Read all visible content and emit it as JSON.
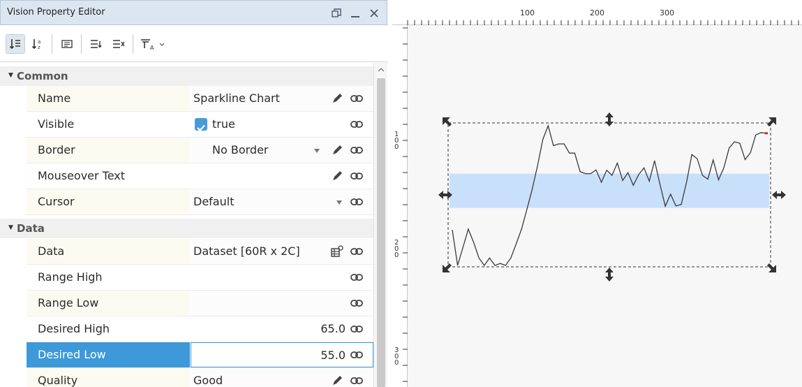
{
  "window": {
    "title": "Vision Property Editor",
    "restore_icon": "restore-icon",
    "minimize_icon": "minimize-icon",
    "close_icon": "close-icon"
  },
  "toolbar": {
    "icons": [
      "sort-by-category-icon",
      "sort-alphabetical-icon",
      "show-descriptions-icon",
      "expand-all-icon",
      "collapse-all-icon",
      "filter-icon",
      "chevron-down-icon"
    ],
    "filter_sub": "A"
  },
  "categories": [
    {
      "label": "Common",
      "properties": [
        {
          "name": "Name",
          "value": "Sparkline Chart"
        },
        {
          "name": "Visible",
          "value": "true",
          "checked": true
        },
        {
          "name": "Border",
          "value": "No Border"
        },
        {
          "name": "Mouseover Text",
          "value": ""
        },
        {
          "name": "Cursor",
          "value": "Default"
        }
      ]
    },
    {
      "label": "Data",
      "properties": [
        {
          "name": "Data",
          "value": "Dataset [60R x 2C]"
        },
        {
          "name": "Range High",
          "value": ""
        },
        {
          "name": "Range Low",
          "value": ""
        },
        {
          "name": "Desired High",
          "value": "65.0"
        },
        {
          "name": "Desired Low",
          "value": "55.0",
          "selected": true
        },
        {
          "name": "Quality",
          "value": "Good"
        }
      ]
    }
  ],
  "rulers": {
    "top_labels": [
      "100",
      "200",
      "300"
    ],
    "left_labels": [
      [
        "1",
        "0",
        "0"
      ],
      [
        "2",
        "0",
        "0"
      ],
      [
        "3",
        "0",
        "0"
      ]
    ]
  },
  "sparkline": {
    "desired_band": {
      "high": 65.0,
      "low": 55.0
    },
    "series": [
      48.6,
      38.2,
      43.5,
      48.8,
      45.0,
      40.4,
      38.2,
      40.4,
      38.2,
      38.8,
      38.2,
      40.4,
      44.5,
      48.8,
      54.5,
      60.4,
      67.2,
      75.0,
      79.0,
      73.2,
      73.7,
      73.7,
      71.0,
      71.0,
      65.6,
      65.0,
      65.0,
      66.1,
      62.5,
      66.0,
      64.5,
      68.1,
      63.0,
      65.3,
      61.6,
      64.7,
      66.7,
      62.8,
      68.8,
      61.9,
      55.5,
      59.0,
      55.6,
      56.0,
      62.5,
      70.6,
      69.4,
      64.5,
      63.4,
      69.0,
      63.2,
      66.7,
      72.5,
      74.3,
      73.9,
      69.1,
      71.1,
      76.3,
      77.0,
      76.8
    ],
    "accent_color": "#d9d2f8",
    "band_color": "#c9e0fb",
    "line_color": "#3a3a3a"
  },
  "colors": {
    "selection": "#3d99d8",
    "checkbox": "#4a9ad8",
    "title_bar": "#dce6f1"
  }
}
